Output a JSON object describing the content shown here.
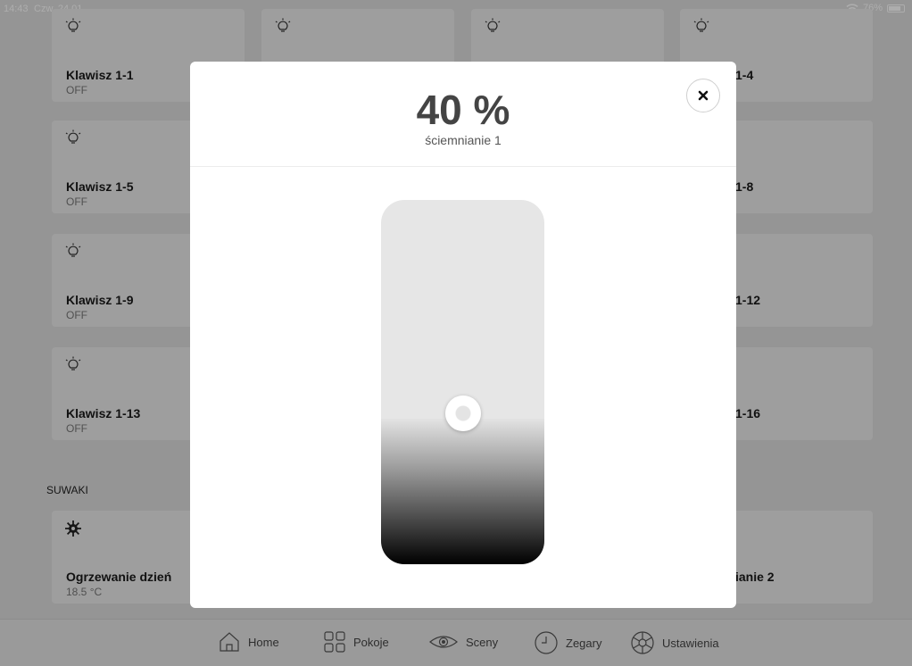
{
  "status": {
    "time": "14:43",
    "date": "Czw. 24.01",
    "battery": "76%"
  },
  "tiles": [
    {
      "name": "Klawisz 1-1",
      "state": "OFF",
      "icon": "bulb-icon"
    },
    {
      "name": "",
      "state": "",
      "icon": "bulb-icon"
    },
    {
      "name": "",
      "state": "",
      "icon": "bulb-icon"
    },
    {
      "name": "1-4",
      "state": "",
      "icon": "bulb-icon"
    },
    {
      "name": "Klawisz 1-5",
      "state": "OFF",
      "icon": "bulb-icon"
    },
    {
      "name": "1-8",
      "state": ""
    },
    {
      "name": "Klawisz 1-9",
      "state": "OFF",
      "icon": "bulb-icon"
    },
    {
      "name": "1-12",
      "state": ""
    },
    {
      "name": "Klawisz 1-13",
      "state": "OFF",
      "icon": "bulb-icon"
    },
    {
      "name": "1-16",
      "state": ""
    },
    {
      "name": "Ogrzewanie dzień",
      "state": "18.5 °C",
      "icon": "sun-icon"
    },
    {
      "name": "ianie 2",
      "state": ""
    }
  ],
  "section": {
    "sliders": "SUWAKI"
  },
  "modal": {
    "value": "40 %",
    "name": "ściemnianie 1",
    "level": 0.4
  },
  "nav": [
    {
      "label": "Home",
      "icon": "home-icon"
    },
    {
      "label": "Pokoje",
      "icon": "rooms-icon"
    },
    {
      "label": "Sceny",
      "icon": "eye-icon"
    },
    {
      "label": "Zegary",
      "icon": "clock-icon"
    },
    {
      "label": "Ustawienia",
      "icon": "settings-icon"
    }
  ]
}
